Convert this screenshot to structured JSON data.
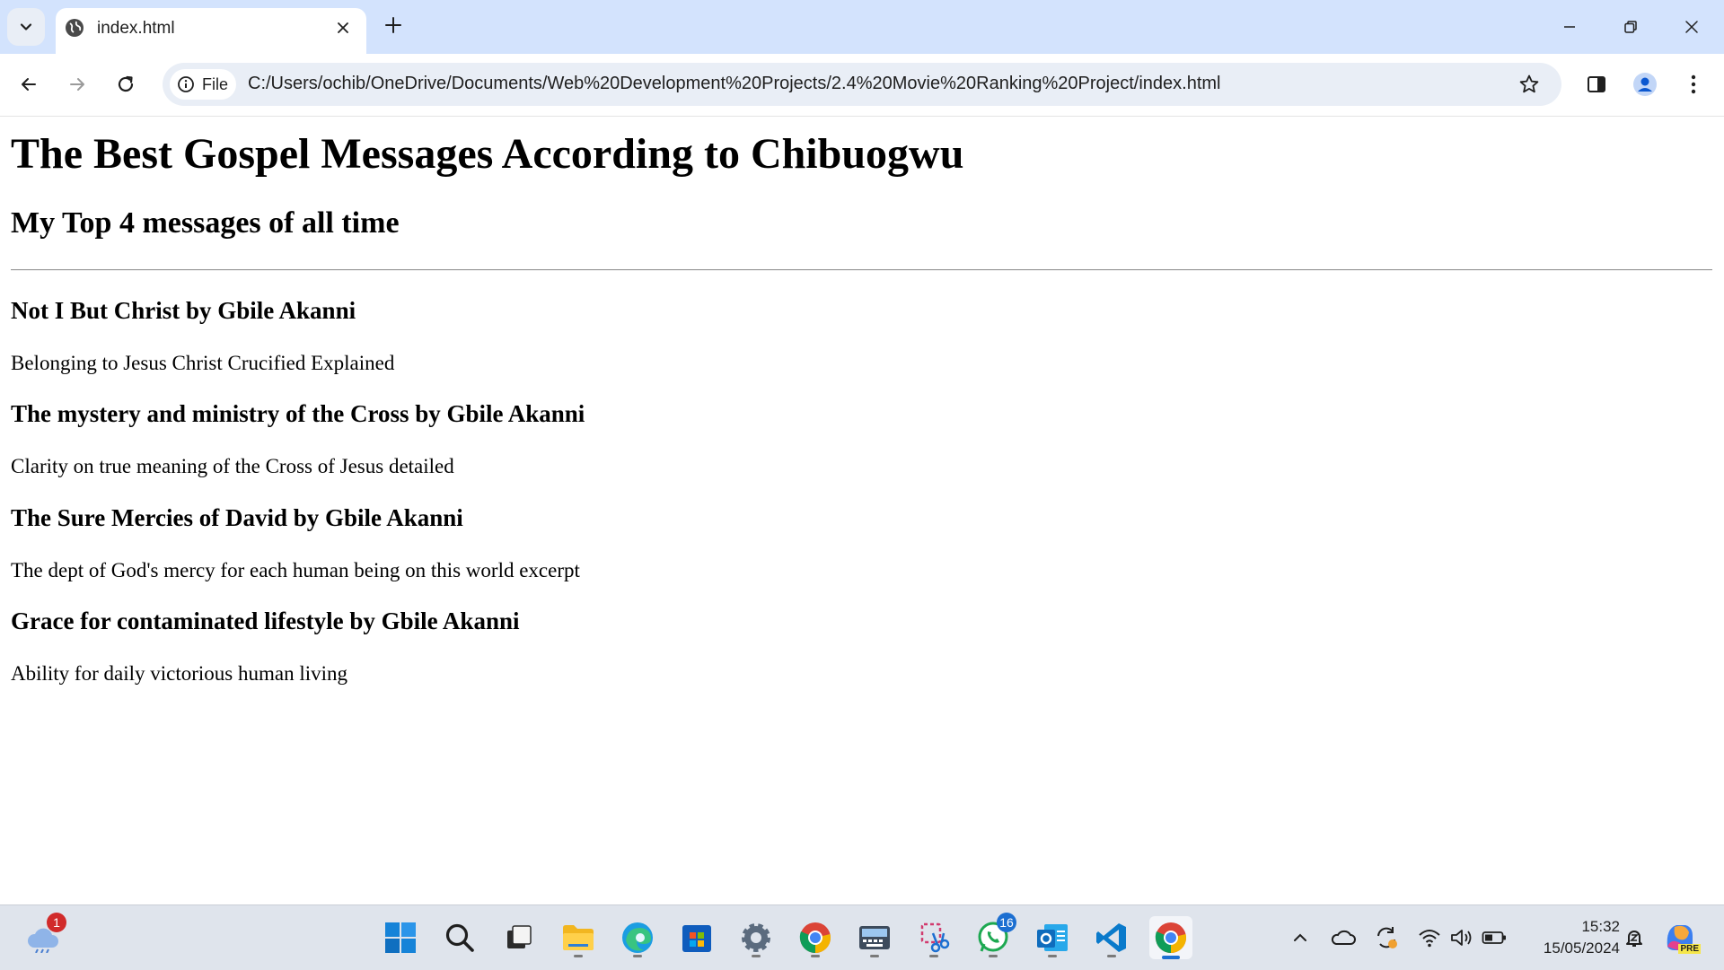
{
  "browser": {
    "tab_title": "index.html",
    "site_chip_label": "File",
    "url": "C:/Users/ochib/OneDrive/Documents/Web%20Development%20Projects/2.4%20Movie%20Ranking%20Project/index.html"
  },
  "page": {
    "heading": "The Best Gospel Messages According to Chibuogwu",
    "subheading": "My Top 4 messages of all time",
    "messages": [
      {
        "title": "Not I But Christ by Gbile Akanni",
        "description": "Belonging to Jesus Christ Crucified Explained"
      },
      {
        "title": "The mystery and ministry of the Cross by Gbile Akanni",
        "description": "Clarity on true meaning of the Cross of Jesus detailed"
      },
      {
        "title": "The Sure Mercies of David by Gbile Akanni",
        "description": "The dept of God's mercy for each human being on this world excerpt"
      },
      {
        "title": "Grace for contaminated lifestyle by Gbile Akanni",
        "description": "Ability for daily victorious human living"
      }
    ]
  },
  "taskbar": {
    "weather_badge": "1",
    "whatsapp_badge": "16",
    "copilot_label": "PRE",
    "time": "15:32",
    "date": "15/05/2024",
    "pinned_icons": [
      "start-icon",
      "search-icon",
      "task-view-icon",
      "file-explorer-icon",
      "edge-icon",
      "store-icon",
      "settings-icon",
      "chrome-icon",
      "keyboard-app-icon",
      "snipping-tool-icon",
      "whatsapp-icon",
      "outlook-icon",
      "vscode-icon",
      "chrome-active-icon"
    ]
  },
  "colors": {
    "tab_strip": "#d3e3fd",
    "omnibox": "#e9eef6",
    "taskbar": "#dfe4ec",
    "accent": "#1c6fd1"
  }
}
